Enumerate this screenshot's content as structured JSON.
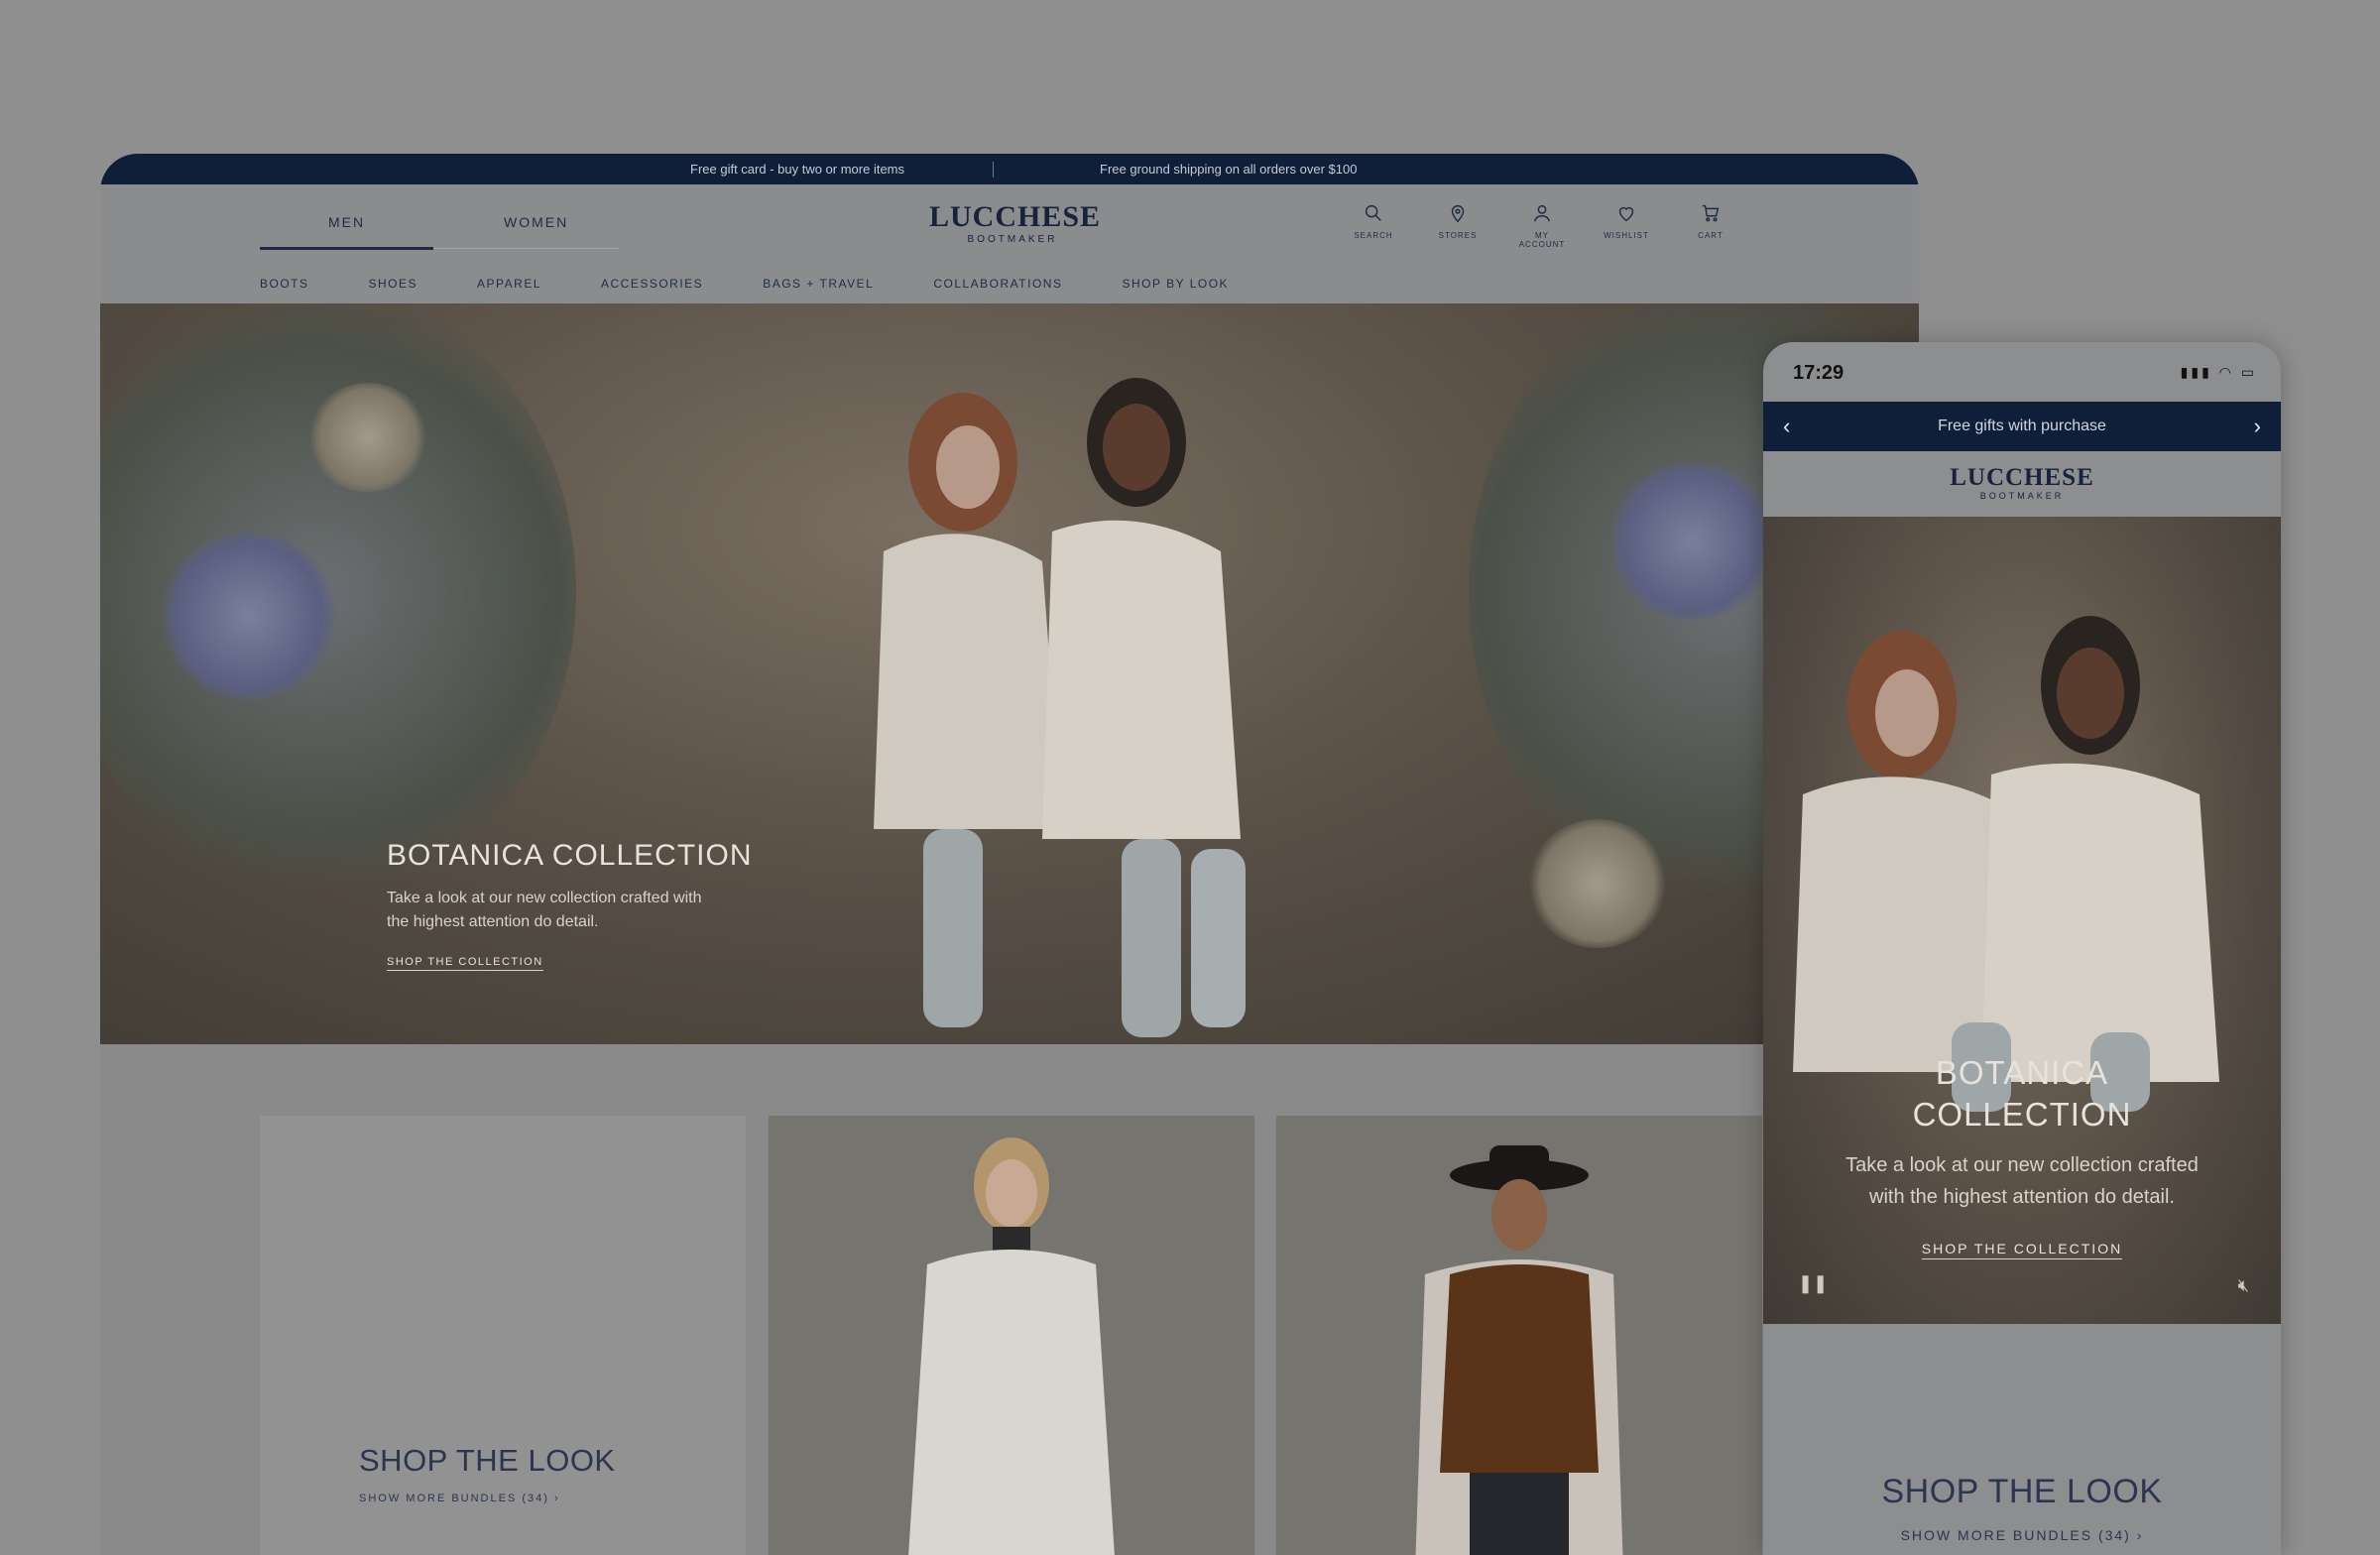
{
  "desktop": {
    "promo": {
      "left": "Free gift card - buy two or more items",
      "right": "Free ground shipping on all orders over $100"
    },
    "gender_tabs": [
      "MEN",
      "WOMEN"
    ],
    "logo": {
      "name": "LUCCHESE",
      "tagline": "BOOTMAKER"
    },
    "utility": [
      {
        "icon": "search-icon",
        "label": "SEARCH"
      },
      {
        "icon": "location-icon",
        "label": "STORES"
      },
      {
        "icon": "account-icon",
        "label": "MY ACCOUNT"
      },
      {
        "icon": "heart-icon",
        "label": "WISHLIST"
      },
      {
        "icon": "cart-icon",
        "label": "CART"
      }
    ],
    "categories": [
      "BOOTS",
      "SHOES",
      "APPAREL",
      "ACCESSORIES",
      "BAGS + TRAVEL",
      "COLLABORATIONS",
      "SHOP BY LOOK"
    ],
    "hero": {
      "title": "BOTANICA COLLECTION",
      "subtitle": "Take a look at our new collection crafted with the highest attention do detail.",
      "cta": "SHOP THE COLLECTION"
    },
    "look": {
      "title": "SHOP THE LOOK",
      "more": "SHOW MORE BUNDLES (34)"
    }
  },
  "mobile": {
    "time": "17:29",
    "promo": "Free gifts with purchase",
    "logo": {
      "name": "LUCCHESE",
      "tagline": "BOOTMAKER"
    },
    "hero": {
      "title_line1": "BOTANICA",
      "title_line2": "COLLECTION",
      "subtitle_line1": "Take a look at our new collection crafted",
      "subtitle_line2": "with the highest attention do detail.",
      "cta": "SHOP THE COLLECTION"
    },
    "look": {
      "title": "SHOP THE LOOK",
      "more": "SHOW MORE BUNDLES (34)"
    }
  },
  "colors": {
    "navy": "#0f1f3a",
    "overlay_bg": "#8f8f8f",
    "text_dark": "#1f2b45"
  }
}
